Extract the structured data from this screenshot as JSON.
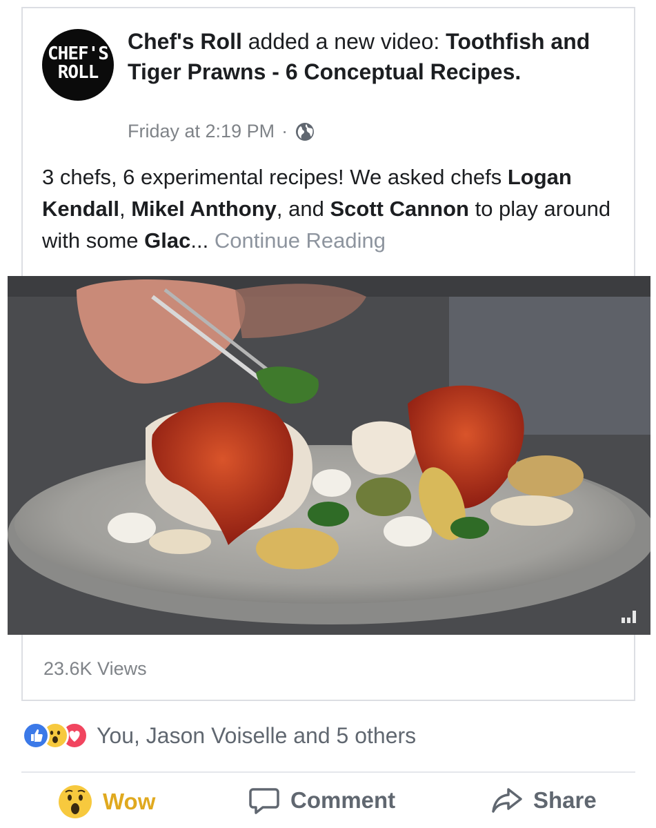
{
  "post": {
    "avatar_line1": "CHEF'S",
    "avatar_line2": "ROLL",
    "page_name": "Chef's Roll",
    "action_text": " added a new video: ",
    "video_title": "Toothfish and Tiger Prawns - 6 Conceptual Recipes.",
    "timestamp": "Friday at 2:19 PM",
    "separator": "·",
    "privacy_icon": "globe-icon",
    "body_part1": "3 chefs, 6 experimental recipes! We asked chefs ",
    "chef1": "Logan Kendall",
    "comma1": ", ",
    "chef2": "Mikel Anthony",
    "and_text": ", and ",
    "chef3": "Scott Cannon",
    "body_part2": " to play around with some ",
    "tag": "Glac",
    "ellipsis": "... ",
    "continue_label": "Continue Reading"
  },
  "video": {
    "quality_icon": "signal-bars-icon"
  },
  "stats": {
    "views": "23.6K Views"
  },
  "reactions": {
    "icons": [
      "like-icon",
      "wow-icon",
      "love-icon"
    ],
    "summary": "You, Jason Voiselle and 5 others"
  },
  "actions": {
    "wow_label": "Wow",
    "comment_label": "Comment",
    "share_label": "Share"
  },
  "colors": {
    "like": "#3b79e8",
    "wow": "#f7c93e",
    "love": "#f1455f",
    "wow_text": "#e0a91f",
    "muted": "#7f8388"
  }
}
